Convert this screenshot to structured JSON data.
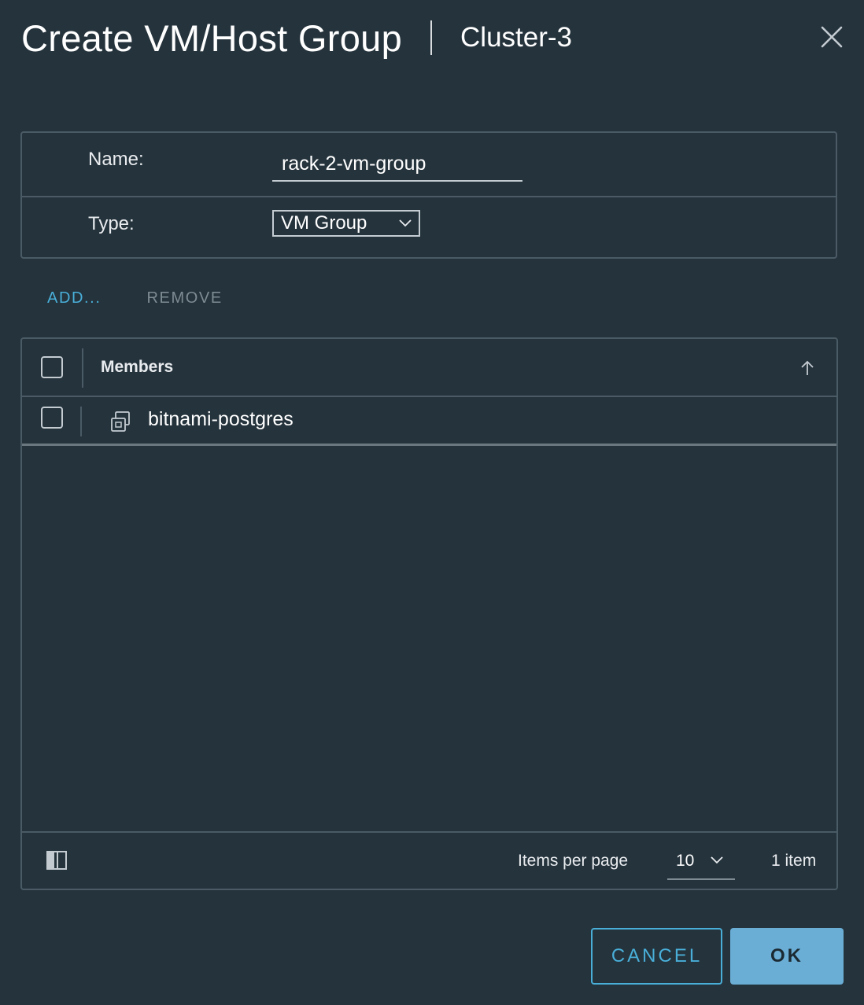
{
  "dialog": {
    "title": "Create VM/Host Group",
    "subtitle": "Cluster-3",
    "close_icon": "close-icon"
  },
  "form": {
    "name_label": "Name:",
    "name_value": "rack-2-vm-group",
    "type_label": "Type:",
    "type_value": "VM Group"
  },
  "actions": {
    "add_label": "ADD...",
    "remove_label": "REMOVE"
  },
  "grid": {
    "column_header": "Members",
    "sort": "ascending",
    "rows": [
      {
        "name": "bitnami-postgres",
        "icon": "vm-icon"
      }
    ],
    "footer": {
      "items_per_page_label": "Items per page",
      "items_per_page_value": "10",
      "count_text": "1 item"
    }
  },
  "buttons": {
    "cancel_label": "CANCEL",
    "ok_label": "OK"
  },
  "colors": {
    "background": "#25333c",
    "accent": "#49afd9",
    "primary_button": "#6aaed6",
    "border": "#4a5b66"
  }
}
